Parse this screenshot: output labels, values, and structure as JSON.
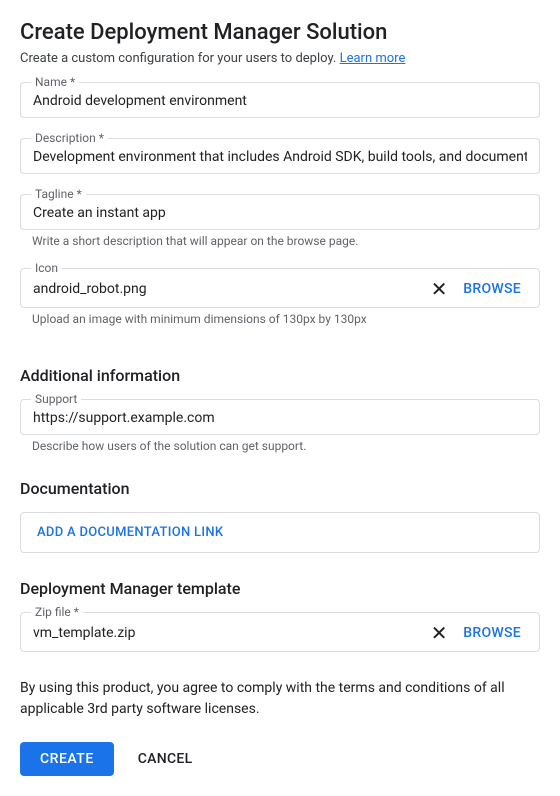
{
  "header": {
    "title": "Create Deployment Manager Solution",
    "subtitle_prefix": "Create a custom configuration for your users to deploy. ",
    "learn_more": "Learn more"
  },
  "fields": {
    "name": {
      "label": "Name *",
      "value": "Android development environment"
    },
    "description": {
      "label": "Description *",
      "value": "Development environment that includes Android SDK, build tools, and documentation."
    },
    "tagline": {
      "label": "Tagline *",
      "value": "Create an instant app",
      "helper": "Write a short description that will appear on the browse page."
    },
    "icon": {
      "label": "Icon",
      "value": "android_robot.png",
      "browse": "BROWSE",
      "helper": "Upload an image with minimum dimensions of 130px by 130px"
    }
  },
  "additional": {
    "header": "Additional information",
    "support": {
      "label": "Support",
      "value": "https://support.example.com",
      "helper": "Describe how users of the solution can get support."
    }
  },
  "documentation": {
    "header": "Documentation",
    "add_link": "ADD A DOCUMENTATION LINK"
  },
  "template": {
    "header": "Deployment Manager template",
    "zip": {
      "label": "Zip file *",
      "value": "vm_template.zip",
      "browse": "BROWSE"
    }
  },
  "terms": "By using this product, you agree to comply with the terms and conditions of all applicable 3rd party software licenses.",
  "actions": {
    "create": "CREATE",
    "cancel": "CANCEL"
  }
}
